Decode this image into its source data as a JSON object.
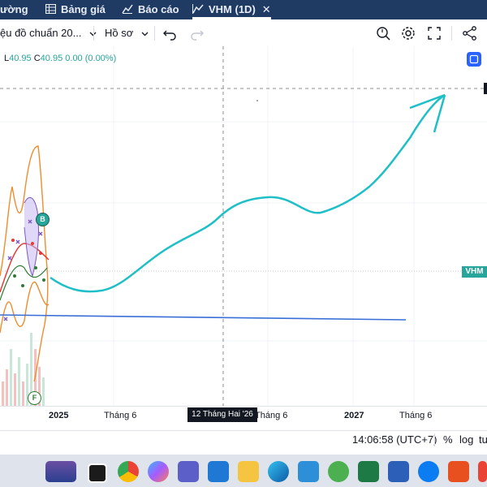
{
  "nav": {
    "market": "ường",
    "price_board": "Bảng giá",
    "reports": "Báo cáo",
    "active_tab": "VHM (1D)",
    "close": "✕"
  },
  "toolbar": {
    "template": "ệu đồ chuẩn 20...",
    "profile": "Hồ sơ"
  },
  "legend": {
    "l_label": "L",
    "l_value": "40.95",
    "c_label": "C",
    "c_value": "40.95",
    "change": "0.00 (0.00%)"
  },
  "markers": {
    "buy": "B",
    "fib": "F"
  },
  "price_tag": "VHM",
  "x_axis": {
    "labels": [
      "2025",
      "Tháng 6",
      "Tháng 6",
      "2027",
      "Tháng 6"
    ],
    "crosshair_date": "12 Tháng Hai '26"
  },
  "status": {
    "clock": "14:06:58 (UTC+7)",
    "percent": "%",
    "log": "log",
    "auto": "tu"
  },
  "colors": {
    "nav_bg": "#1f3a63",
    "projection_line": "#1fbfc7",
    "trend_line": "#3a6fd8",
    "accent": "#2962ff",
    "price_tag": "#26a69a"
  },
  "taskbar": {
    "icons": [
      "weather-icon",
      "terminal-icon",
      "chrome-icon",
      "copilot-icon",
      "teams-icon",
      "store-icon",
      "folder-icon",
      "edge-icon",
      "misa-icon",
      "zalo-pc-icon",
      "excel-icon",
      "word-icon",
      "zalo-icon",
      "reader-icon",
      "chrome-alt-icon"
    ]
  }
}
